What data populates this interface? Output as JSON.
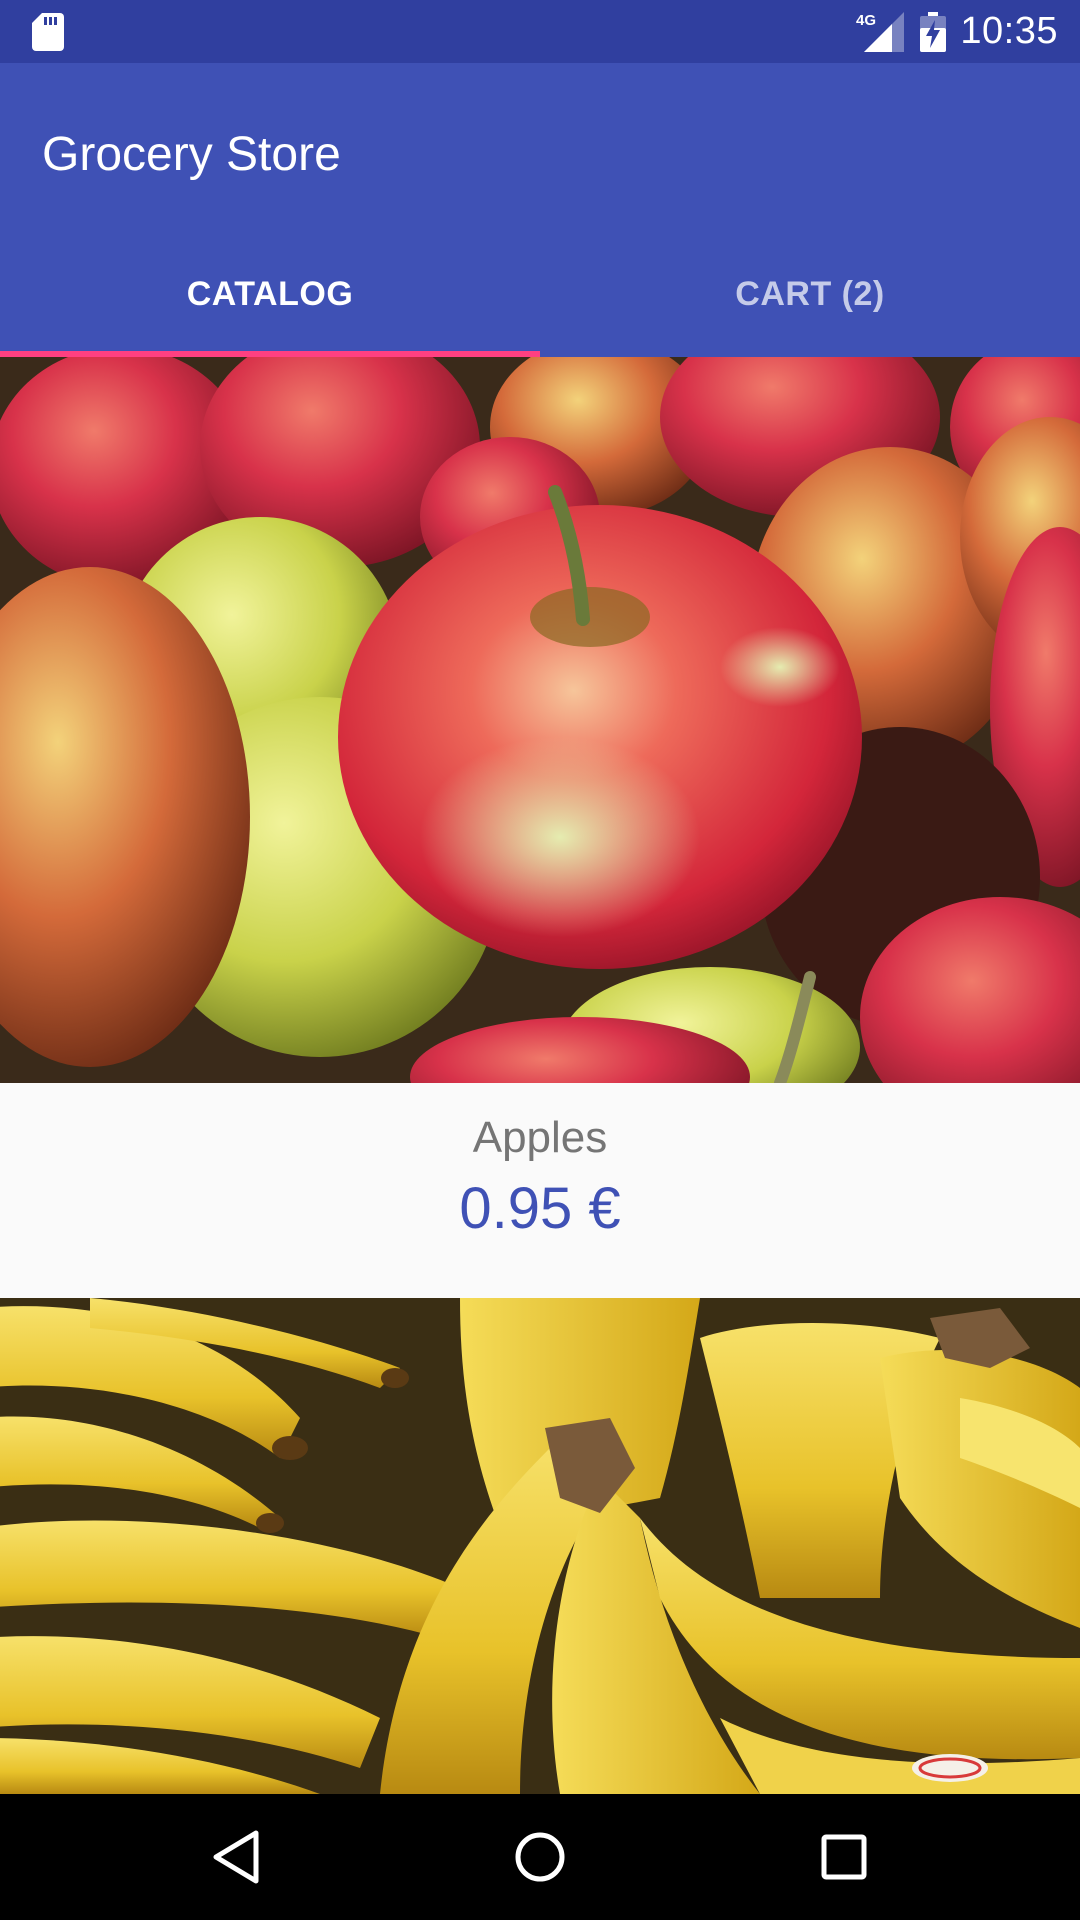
{
  "status_bar": {
    "time": "10:35",
    "network_label": "4G",
    "icons": [
      "sd-card-icon",
      "signal-icon",
      "battery-charging-icon"
    ]
  },
  "app_bar": {
    "title": "Grocery Store"
  },
  "tabs": [
    {
      "label": "CATALOG",
      "selected": true
    },
    {
      "label": "CART (2)",
      "selected": false
    }
  ],
  "products": [
    {
      "name": "Apples",
      "price": "0.95 €",
      "image": "apples-photo"
    },
    {
      "name": "",
      "price": "",
      "image": "bananas-photo"
    }
  ],
  "nav_bar": {
    "icons": [
      "back-icon",
      "home-icon",
      "recents-icon"
    ]
  },
  "colors": {
    "primary": "#3f51b5",
    "primary_dark": "#303f9f",
    "accent": "#ff4081",
    "price_text": "#3f51b5",
    "name_text": "#757575"
  }
}
